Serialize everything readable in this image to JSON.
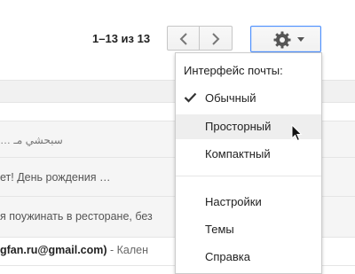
{
  "toolbar": {
    "range_text": "1–13 из 13",
    "prev_icon": "chevron-left-icon",
    "next_icon": "chevron-right-icon",
    "settings_icon": "gear-icon"
  },
  "messages": [
    {
      "text": "… سبحشي مـ"
    },
    {
      "text": "ет! День рождения …"
    },
    {
      "text": "я поужинать в ресторане, без"
    },
    {
      "sender": "gfan.ru@gmail.com)",
      "rest": " - Кален"
    }
  ],
  "settings_menu": {
    "header": "Интерфейс почты:",
    "density_options": [
      {
        "label": "Обычный",
        "selected": true
      },
      {
        "label": "Просторный",
        "selected": false
      },
      {
        "label": "Компактный",
        "selected": false
      }
    ],
    "actions": [
      {
        "label": "Настройки"
      },
      {
        "label": "Темы"
      },
      {
        "label": "Справка"
      }
    ]
  },
  "colors": {
    "accent_border": "#4d90fe",
    "hover_bg": "#eeeeee"
  }
}
